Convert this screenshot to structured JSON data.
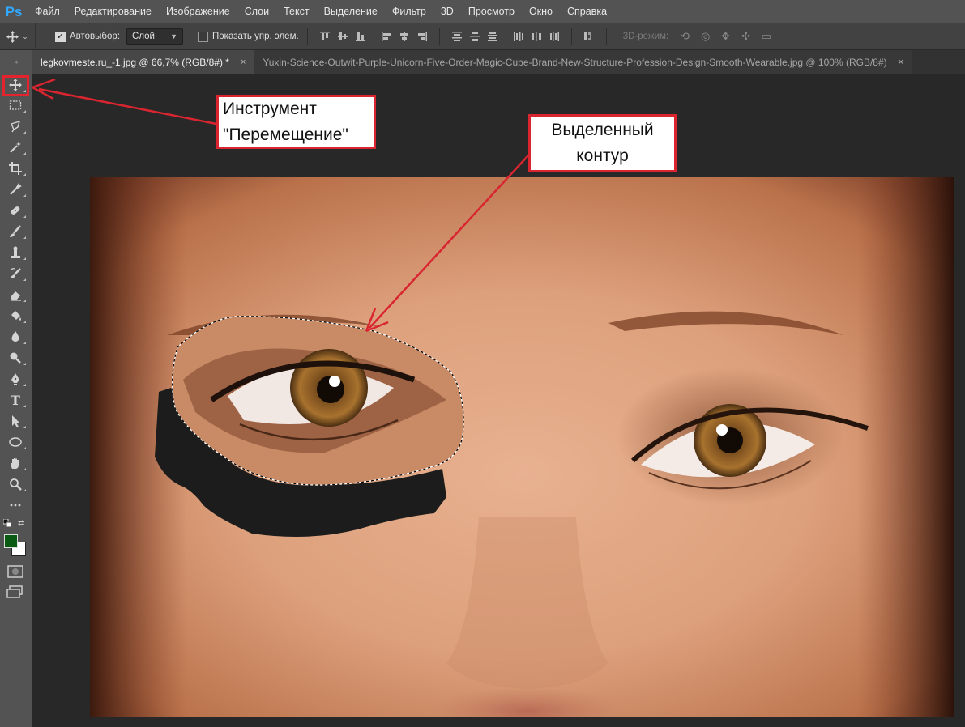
{
  "app": {
    "logo": "Ps",
    "brand_color": "#31a8ff"
  },
  "menu": [
    "Файл",
    "Редактирование",
    "Изображение",
    "Слои",
    "Текст",
    "Выделение",
    "Фильтр",
    "3D",
    "Просмотр",
    "Окно",
    "Справка"
  ],
  "options_bar": {
    "auto_select_label": "Автовыбор:",
    "auto_select_checked": true,
    "auto_select_value": "Слой",
    "show_controls_label": "Показать упр. элем.",
    "show_controls_checked": false,
    "mode_3d_label": "3D-режим:"
  },
  "tabs": [
    {
      "title": "legkovmeste.ru_-1.jpg @ 66,7% (RGB/8#) *",
      "close": "×",
      "active": true
    },
    {
      "title": "Yuxin-Science-Outwit-Purple-Unicorn-Five-Order-Magic-Cube-Brand-New-Structure-Profession-Design-Smooth-Wearable.jpg @ 100% (RGB/8#)",
      "close": "×",
      "active": false
    }
  ],
  "tools": [
    "move-tool",
    "marquee-tool",
    "lasso-tool",
    "magic-wand-tool",
    "crop-tool",
    "eyedropper-tool",
    "healing-brush-tool",
    "brush-tool",
    "clone-stamp-tool",
    "history-brush-tool",
    "eraser-tool",
    "paint-bucket-tool",
    "blur-tool",
    "dodge-tool",
    "pen-tool",
    "type-tool",
    "path-selection-tool",
    "ellipse-tool",
    "hand-tool",
    "zoom-tool",
    "more-tools"
  ],
  "type_tool_glyph": "T",
  "colors": {
    "foreground": "#0b5a13",
    "background": "#ffffff",
    "annotation": "#d92530"
  },
  "annotations": {
    "move_tool_line1": "Инструмент",
    "move_tool_line2": "\"Перемещение\"",
    "selection_line1": "Выделенный",
    "selection_line2": "контур"
  }
}
